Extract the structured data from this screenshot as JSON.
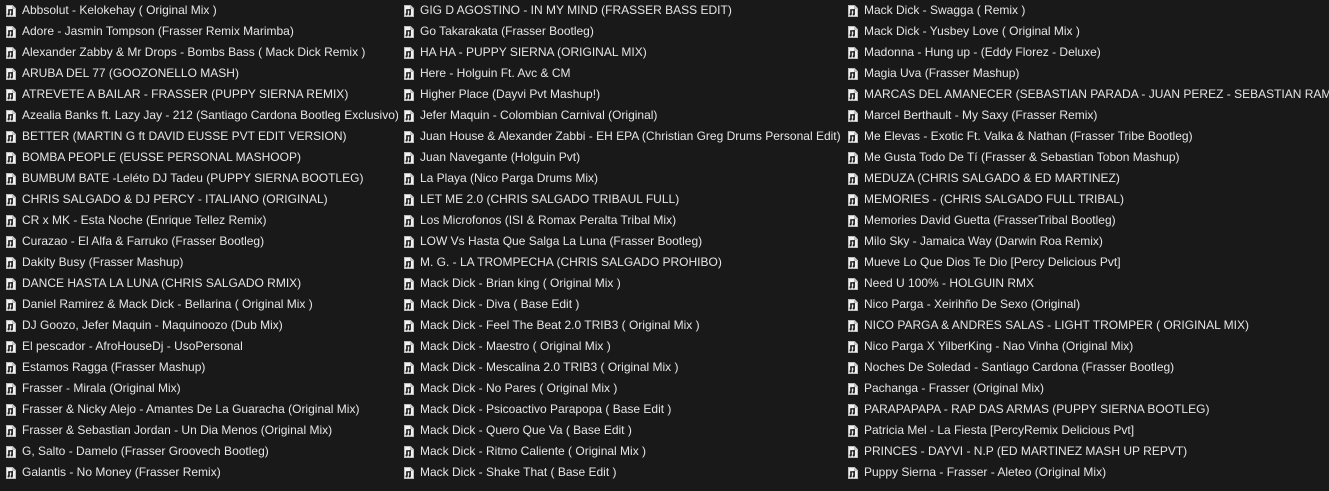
{
  "icons": {
    "file": "audio-file-icon"
  },
  "columns": [
    {
      "items": [
        "Abbsolut - Kelokehay ( Original Mix )",
        "Adore - Jasmin Tompson (Frasser Remix Marimba)",
        "Alexander Zabby & Mr Drops - Bombs Bass ( Mack Dick Remix )",
        "ARUBA DEL 77 (GOOZONELLO MASH)",
        "ATREVETE A BAILAR - FRASSER (PUPPY SIERNA REMIX)",
        "Azealia Banks ft. Lazy Jay - 212 (Santiago Cardona Bootleg Exclusivo)",
        "BETTER (MARTIN G ft DAVID EUSSE PVT EDIT VERSION)",
        "BOMBA PEOPLE (EUSSE PERSONAL MASHOOP)",
        "BUMBUM BATE -Leléto DJ Tadeu  (PUPPY SIERNA BOOTLEG)",
        "CHRIS SALGADO & DJ PERCY - ITALIANO  (ORIGINAL)",
        "CR x MK - Esta Noche (Enrique Tellez Remix)",
        "Curazao - El Alfa & Farruko (Frasser Bootleg)",
        "Dakity Busy (Frasser Mashup)",
        "DANCE HASTA LA LUNA (CHRIS SALGADO RMIX)",
        "Daniel Ramirez & Mack Dick - Bellarina ( Original Mix )",
        "DJ Goozo, Jefer Maquin - Maquinoozo (Dub Mix)",
        "El pescador - AfroHouseDj - UsoPersonal",
        "Estamos Ragga (Frasser Mashup)",
        "Frasser - Mirala (Original Mix)",
        "Frasser & Nicky Alejo - Amantes De La Guaracha (Original Mix)",
        "Frasser & Sebastian Jordan - Un Dia Menos (Original Mix)",
        "G, Salto - Damelo (Frasser Groovech Bootleg)",
        "Galantis - No Money (Frasser Remix)"
      ]
    },
    {
      "items": [
        "GIG D AGOSTINO - IN MY MIND (FRASSER BASS EDIT)",
        "Go Takarakata (Frasser Bootleg)",
        "HA HA - PUPPY SIERNA (ORIGINAL MIX)",
        "Here - Holguin Ft. Avc & CM",
        "Higher Place (Dayvi Pvt Mashup!)",
        "Jefer Maquin - Colombian Carnival (Original)",
        "Juan House & Alexander Zabbi - EH EPA (Christian Greg Drums Personal Edit)",
        "Juan Navegante (Holguin Pvt)",
        "La Playa (Nico Parga Drums Mix)",
        "LET ME 2.0 (CHRIS SALGADO TRIBAUL FULL)",
        "Los Microfonos (ISI & Romax Peralta Tribal Mix)",
        "LOW Vs Hasta Que Salga La Luna (Frasser Bootleg)",
        "M. G. - LA TROMPECHA (CHRIS SALGADO PROHIBO)",
        "Mack Dick - Brian king ( Original Mix )",
        "Mack Dick - Diva ( Base Edit )",
        "Mack Dick - Feel The Beat 2.0 TRIB3 ( Original Mix )",
        "Mack Dick - Maestro ( Original Mix )",
        "Mack Dick - Mescalina 2.0 TRIB3 ( Original Mix )",
        "Mack Dick - No Pares ( Original Mix )",
        "Mack Dick - Psicoactivo Parapopa ( Base Edit )",
        "Mack Dick - Quero Que Va  ( Base Edit )",
        "Mack Dick - Ritmo Caliente ( Original Mix )",
        "Mack Dick - Shake That ( Base Edit )"
      ]
    },
    {
      "items": [
        "Mack Dick - Swagga (  Remix )",
        "Mack Dick - Yusbey Love ( Original Mix )",
        "Madonna - Hung up -  (Eddy Florez  - Deluxe)",
        "Magia Uva (Frasser Mashup)",
        "MARCAS DEL AMANECER (SEBASTIAN PARADA - JUAN PEREZ - SEBASTIAN RAMIREZ)",
        "Marcel Berthault - My Saxy (Frasser Remix)",
        "Me Elevas - Exotic Ft. Valka & Nathan (Frasser Tribe Bootleg)",
        "Me Gusta Todo De Tí (Frasser & Sebastian Tobon Mashup)",
        "MEDUZA (CHRIS SALGADO & ED MARTINEZ)",
        "MEMORIES - (CHRIS SALGADO FULL TRIBAL)",
        "Memories David Guetta (FrasserTribal Bootleg)",
        "Milo Sky - Jamaica Way (Darwin Roa Remix)",
        "Mueve Lo Que Dios Te Dio [Percy Delicious Pvt]",
        "Need U 100% - HOLGUIN RMX",
        "Nico Parga - Xeirihño De Sexo (Original)",
        "NICO PARGA & ANDRES SALAS - LIGHT TROMPER ( ORIGINAL MIX)",
        "Nico Parga X YilberKing - Nao Vinha (Original Mix)",
        "Noches De Soledad - Santiago Cardona (Frasser Bootleg)",
        "Pachanga - Frasser (Original Mix)",
        "PARAPAPAPA - RAP DAS ARMAS (PUPPY SIERNA BOOTLEG)",
        "Patricia Mel - La Fiesta [PercyRemix Delicious Pvt]",
        "PRINCES - DAYVI - N.P (ED MARTINEZ MASH UP REPVT)",
        "Puppy Sierna - Frasser - Aleteo (Original Mix)"
      ]
    }
  ]
}
